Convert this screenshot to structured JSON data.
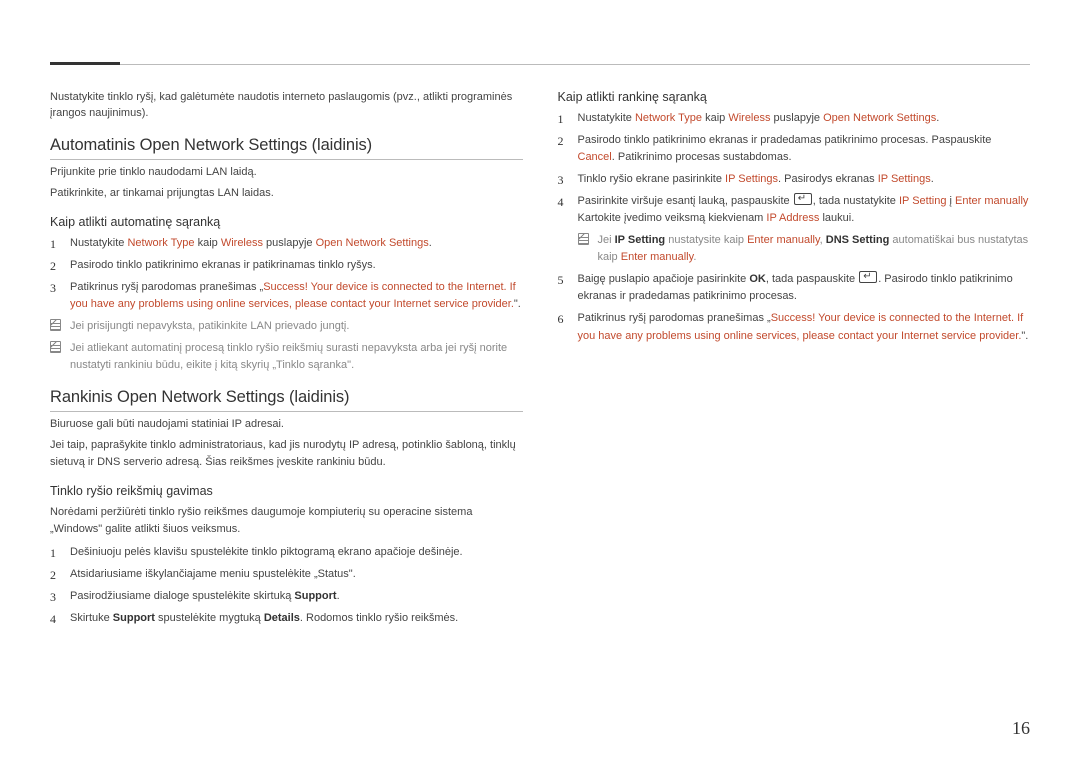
{
  "page_number": "16",
  "left": {
    "intro": "Nustatykite tinklo ryšį, kad galėtumėte naudotis interneto paslaugomis (pvz., atlikti programinės įrangos naujinimus).",
    "section_auto": "Automatinis Open Network Settings (laidinis)",
    "auto_p1": "Prijunkite prie tinklo naudodami LAN laidą.",
    "auto_p2": "Patikrinkite, ar tinkamai prijungtas LAN laidas.",
    "sub_auto": "Kaip atlikti automatinę sąranką",
    "auto_step1_a": "Nustatykite ",
    "auto_step1_b": "Network Type",
    "auto_step1_c": " kaip ",
    "auto_step1_d": "Wireless",
    "auto_step1_e": " puslapyje ",
    "auto_step1_f": "Open Network Settings",
    "auto_step1_g": ".",
    "auto_step2": "Pasirodo tinklo patikrinimo ekranas ir patikrinamas tinklo ryšys.",
    "auto_step3_a": "Patikrinus ryšį parodomas pranešimas „",
    "auto_step3_b": "Success! Your device is connected to the Internet. If you have any problems using online services, please contact your Internet service provider.",
    "auto_step3_c": "\".",
    "auto_note1": "Jei prisijungti nepavyksta, patikinkite LAN prievado jungtį.",
    "auto_note2": "Jei atliekant automatinį procesą tinklo ryšio reikšmių surasti nepavyksta arba jei ryšį norite nustatyti rankiniu būdu, eikite į kitą skyrių „Tinklo sąranka\".",
    "section_manual": "Rankinis Open Network Settings (laidinis)",
    "man_p1": "Biuruose gali būti naudojami statiniai IP adresai.",
    "man_p2": "Jei taip, paprašykite tinklo administratoriaus, kad jis nurodytų IP adresą, potinklio šabloną, tinklų sietuvą ir DNS serverio adresą. Šias reikšmes įveskite rankiniu būdu.",
    "sub_values": "Tinklo ryšio reikšmių gavimas",
    "val_intro": "Norėdami peržiūrėti tinklo ryšio reikšmes daugumoje kompiuterių su operacine sistema „Windows\" galite atlikti šiuos veiksmus.",
    "val_step1": "Dešiniuoju pelės klavišu spustelėkite tinklo piktogramą ekrano apačioje dešinėje.",
    "val_step2": "Atsidariusiame iškylančiajame meniu spustelėkite „Status\".",
    "val_step3_a": "Pasirodžiusiame dialoge spustelėkite skirtuką ",
    "val_step3_b": "Support",
    "val_step3_c": ".",
    "val_step4_a": "Skirtuke ",
    "val_step4_b": "Support",
    "val_step4_c": " spustelėkite mygtuką ",
    "val_step4_d": "Details",
    "val_step4_e": ". Rodomos tinklo ryšio reikšmės."
  },
  "right": {
    "sub_manual": "Kaip atlikti rankinę sąranką",
    "r1_a": "Nustatykite ",
    "r1_b": "Network Type",
    "r1_c": " kaip ",
    "r1_d": "Wireless",
    "r1_e": " puslapyje ",
    "r1_f": "Open Network Settings",
    "r1_g": ".",
    "r2_a": "Pasirodo tinklo patikrinimo ekranas ir pradedamas patikrinimo procesas. Paspauskite ",
    "r2_b": "Cancel",
    "r2_c": ". Patikrinimo procesas sustabdomas.",
    "r3_a": "Tinklo ryšio ekrane pasirinkite ",
    "r3_b": "IP Settings",
    "r3_c": ". Pasirodys ekranas ",
    "r3_d": "IP Settings",
    "r3_e": ".",
    "r4_a": "Pasirinkite viršuje esantį lauką, paspauskite ",
    "r4_b": ", tada nustatykite ",
    "r4_c": "IP Setting",
    "r4_d": " į ",
    "r4_e": "Enter manually",
    "r4_f": " Kartokite įvedimo veiksmą kiekvienam ",
    "r4_g": "IP Address",
    "r4_h": " laukui.",
    "r4_note_a": "Jei ",
    "r4_note_b": "IP Setting",
    "r4_note_c": " nustatysite kaip ",
    "r4_note_d": "Enter manually",
    "r4_note_e": ", ",
    "r4_note_f": "DNS Setting",
    "r4_note_g": " automatiškai bus nustatytas kaip ",
    "r4_note_h": "Enter manually",
    "r4_note_i": ".",
    "r5_a": "Baigę puslapio apačioje pasirinkite ",
    "r5_b": "OK",
    "r5_c": ", tada paspauskite ",
    "r5_d": ". Pasirodo tinklo patikrinimo ekranas ir pradedamas patikrinimo procesas.",
    "r6_a": "Patikrinus ryšį parodomas pranešimas „",
    "r6_b": "Success! Your device is connected to the Internet. If you have any problems using online services, please contact your Internet service provider.",
    "r6_c": "\"."
  }
}
